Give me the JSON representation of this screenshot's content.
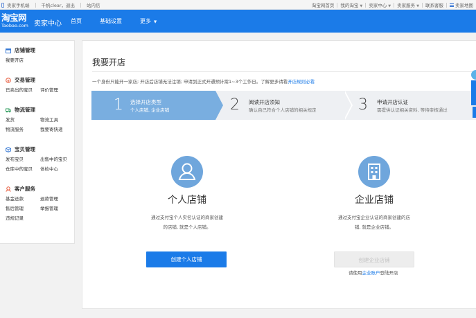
{
  "topbar": {
    "left": {
      "mobile": "卖家手机端",
      "user": "千帆clear，退出",
      "messages": "站内信"
    },
    "right": [
      "淘宝网首页",
      "我的淘宝",
      "卖家中心",
      "卖家服务",
      "联系客服",
      "卖家地图"
    ]
  },
  "header": {
    "logo_cn": "淘宝网",
    "logo_en": "Taobao.com",
    "title": "卖家中心",
    "nav": [
      "首页",
      "基础设置",
      "更多"
    ]
  },
  "sidebar": [
    {
      "title": "店铺管理",
      "links": [
        "我要开店"
      ]
    },
    {
      "title": "交易管理",
      "links": [
        "已卖出的宝贝",
        "评价管理"
      ]
    },
    {
      "title": "物流管理",
      "links": [
        "发货",
        "物流工具",
        "物流服务",
        "我要寄快递"
      ]
    },
    {
      "title": "宝贝管理",
      "links": [
        "发布宝贝",
        "出售中的宝贝",
        "仓库中的宝贝",
        "体检中心"
      ]
    },
    {
      "title": "客户服务",
      "links": [
        "基金还款",
        "退款管理",
        "售后管理",
        "举报管理",
        "违规记录"
      ]
    }
  ],
  "main": {
    "title": "我要开店",
    "notice_text": "一个身份只能开一家店; 开店后店铺无法注销; 申请到正式开通预计需1~3个工作日。了解更多请看",
    "notice_link": "开店规则必看",
    "steps": [
      {
        "num": "1",
        "title": "选择开店类型",
        "sub": "个人店铺, 企业店铺",
        "active": true
      },
      {
        "num": "2",
        "title": "阅读开店须知",
        "sub": "确认自己符合个人店铺的相关规定",
        "active": false
      },
      {
        "num": "3",
        "title": "申请开店认证",
        "sub": "需提供认证相关资料, 等待审核通过",
        "active": false
      }
    ],
    "personal": {
      "title": "个人店铺",
      "desc1": "通过支付宝个人实名认证的商家创建",
      "desc2": "的店铺, 就是个人店铺。",
      "button": "创建个人店铺"
    },
    "enterprise": {
      "title": "企业店铺",
      "desc1": "通过支付宝企业认证的商家创建的店",
      "desc2": "铺, 就是企业店铺。",
      "button": "创建企业店铺",
      "hint_pre": "请使用",
      "hint_link": "企业账户",
      "hint_post": "登陆开店"
    }
  },
  "colors": {
    "brand": "#1b7be8",
    "step_active": "#79aee0",
    "step_inactive": "#eef0f3",
    "icon": "#6fa6dc"
  }
}
